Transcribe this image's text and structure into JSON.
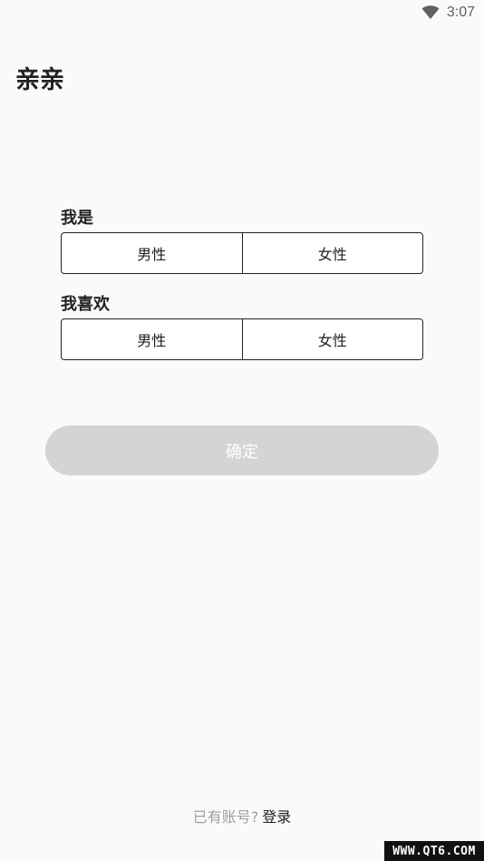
{
  "status_bar": {
    "time": "3:07",
    "wifi_icon": "wifi-icon"
  },
  "app": {
    "title": "亲亲"
  },
  "form": {
    "i_am": {
      "label": "我是",
      "options": [
        "男性",
        "女性"
      ]
    },
    "i_like": {
      "label": "我喜欢",
      "options": [
        "男性",
        "女性"
      ]
    },
    "confirm_label": "确定"
  },
  "footer": {
    "prompt": "已有账号?",
    "login_label": "登录"
  },
  "watermark": {
    "text": "WWW.QT6.COM"
  },
  "colors": {
    "background": "#fafafa",
    "text": "#212121",
    "muted": "#9e9e9e",
    "button_disabled": "#d4d4d4"
  }
}
